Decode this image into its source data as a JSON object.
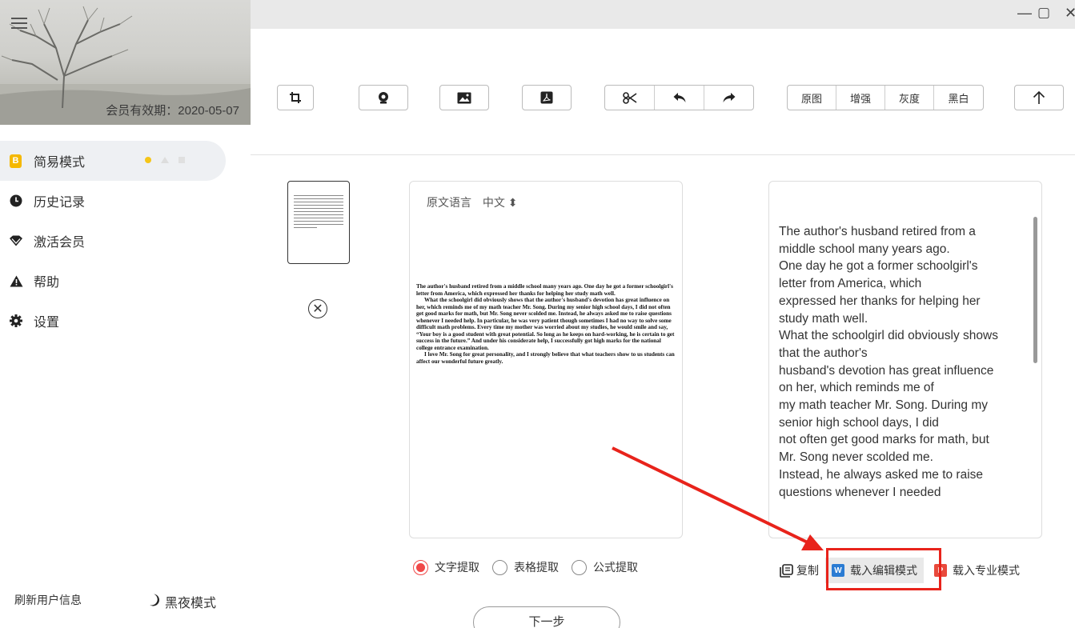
{
  "sidebar": {
    "member_text": "会员有效期：2020-05-07",
    "items": [
      {
        "label": "简易模式",
        "icon": "b-badge-icon"
      },
      {
        "label": "历史记录",
        "icon": "clock-icon"
      },
      {
        "label": "激活会员",
        "icon": "diamond-icon"
      },
      {
        "label": "帮助",
        "icon": "warning-icon"
      },
      {
        "label": "设置",
        "icon": "gear-icon"
      }
    ],
    "refresh_label": "刷新用户信息",
    "night_label": "黑夜模式"
  },
  "window": {
    "minimize": "—",
    "maximize": "▢",
    "close": "✕"
  },
  "toolbar": {
    "filters": [
      "原图",
      "增强",
      "灰度",
      "黑白"
    ]
  },
  "doc": {
    "lang_label": "原文语言",
    "lang_value": "中文 ⬍",
    "paragraphs": [
      "The author's husband retired from a middle school many years ago. One day he got a former schoolgirl's letter from America, which expressed her thanks for helping her study math well.",
      "What the schoolgirl did obviously shows that the author's husband's devotion has great influence on her, which reminds me of my math teacher Mr. Song. During my senior high school days, I did not often get good marks for math, but Mr. Song never scolded me. Instead, he always asked me to raise questions whenever I needed help. In particular, he was very patient though sometimes I had no way to solve some difficult math problems. Every time my mother was worried about my studies, he would smile and say, “Your boy is a good student with great potential. So long as he keeps on hard-working, he is certain to get success in the future.” And under his considerate help, I successfully got high marks for the national college entrance examination.",
      "I love Mr. Song for great personality, and I strongly believe that what teachers show to us students can affect our wonderful future greatly."
    ]
  },
  "result": {
    "lines": [
      "The author's husband retired from a",
      "middle school many years ago.",
      "One day he got a former schoolgirl's",
      "letter from America, which",
      "expressed her thanks for helping her",
      "study math well.",
      "What the schoolgirl did obviously shows",
      "that the author's",
      "husband's devotion has great influence",
      "on her, which reminds me of",
      "my math teacher Mr. Song. During my",
      "senior high school days, I did",
      "not often get good marks for math, but",
      "Mr. Song never scolded me.",
      "Instead, he always asked me to raise",
      "questions whenever I needed"
    ]
  },
  "modes": [
    "文字提取",
    "表格提取",
    "公式提取"
  ],
  "actions": {
    "copy": "复制",
    "load_edit": "载入编辑模式",
    "load_edit_badge": "W",
    "load_pro": "载入专业模式",
    "load_pro_badge": "P"
  },
  "next_label": "下一步",
  "colors": {
    "accent_red": "#e8231b",
    "word_blue": "#2b7cd3",
    "pdf_red": "#e84a3c",
    "badge_yellow": "#f5b800"
  }
}
